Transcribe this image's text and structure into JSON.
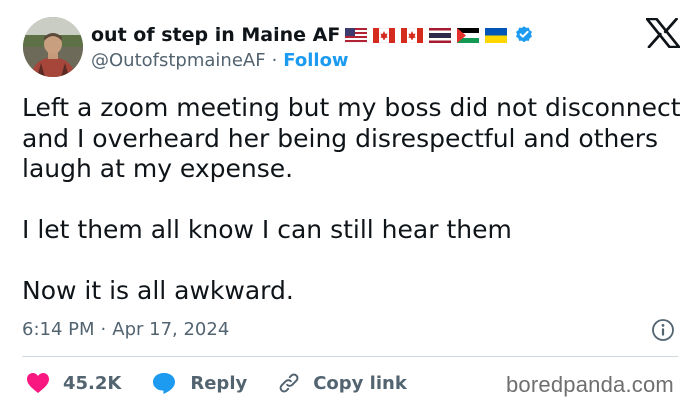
{
  "author": {
    "display_name": "out of step in Maine AF",
    "handle": "@OutofstpmaineAF",
    "separator": "·",
    "follow_label": "Follow",
    "flags": [
      "us-flag",
      "canada-flag",
      "canada-flag",
      "thailand-flag",
      "palestine-flag",
      "ukraine-flag"
    ],
    "verified_icon": "verified-badge-icon",
    "avatar_icon": "avatar"
  },
  "brand_icon": "x-logo-icon",
  "tweet": {
    "lines": [
      "Left a zoom meeting but my boss did not disconnect and I overheard her being disrespectful and others laugh at my expense.",
      "I let them all know I can still hear them",
      "Now it is all awkward."
    ]
  },
  "meta": {
    "time": "6:14 PM",
    "separator": "·",
    "date": "Apr 17, 2024",
    "info_icon": "info-icon"
  },
  "actions": {
    "like_count": "45.2K",
    "like_icon": "heart-icon",
    "reply_label": "Reply",
    "reply_icon": "reply-bubble-icon",
    "copy_label": "Copy link",
    "copy_icon": "link-icon"
  },
  "watermark": "boredpanda.com",
  "colors": {
    "text": "#0f1419",
    "secondary": "#536471",
    "accent": "#1d9bf0",
    "like": "#f91880",
    "divider": "#cfd9de"
  }
}
